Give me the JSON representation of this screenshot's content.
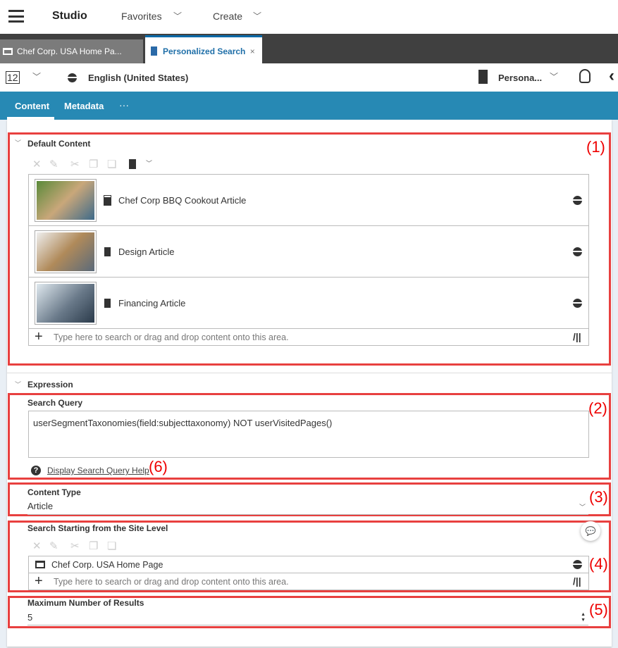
{
  "header": {
    "app": "Studio",
    "favorites": "Favorites",
    "create": "Create"
  },
  "tabs": [
    {
      "label": "Chef Corp. USA Home Pa..."
    },
    {
      "label": "Personalized Search",
      "close": "×"
    }
  ],
  "toolbar": {
    "version": "12",
    "language": "English (United States)",
    "persona": "Persona..."
  },
  "nav": {
    "content": "Content",
    "metadata": "Metadata",
    "more": "···"
  },
  "default_content": {
    "title": "Default Content",
    "marker": "(1)",
    "items": [
      {
        "label": "Chef Corp BBQ Cookout Article"
      },
      {
        "label": "Design Article"
      },
      {
        "label": "Financing Article"
      }
    ],
    "placeholder": "Type here to search or drag and drop content onto this area."
  },
  "expression": {
    "title": "Expression",
    "query": {
      "label": "Search Query",
      "value": "userSegmentTaxonomies(field:subjecttaxonomy) NOT userVisitedPages()",
      "marker": "(2)",
      "help": "Display Search Query Help",
      "help_marker": "(6)"
    },
    "content_type": {
      "label": "Content Type",
      "value": "Article",
      "marker": "(3)"
    },
    "site": {
      "label": "Search Starting from the Site Level",
      "item": "Chef Corp. USA Home Page",
      "placeholder": "Type here to search or drag and drop content onto this area.",
      "marker": "(4)"
    },
    "max": {
      "label": "Maximum Number of Results",
      "value": "5",
      "marker": "(5)"
    }
  },
  "colors": {
    "nav": "#2789b4",
    "annotation": "#e8403f",
    "tabbar": "#404040"
  }
}
